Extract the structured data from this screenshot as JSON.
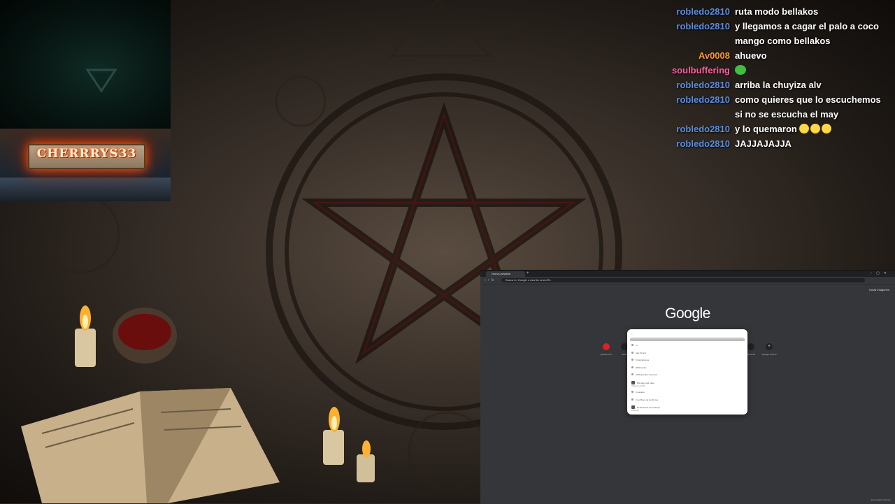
{
  "overlay": {
    "streamer_name": "CHERRRYS33"
  },
  "chat": {
    "messages": [
      {
        "user": "robledo2810",
        "user_color": "#5b8de0",
        "text": "ruta modo bellakos"
      },
      {
        "user": "robledo2810",
        "user_color": "#5b8de0",
        "text": "y llegamos a cagar el palo a coco mango como bellakos"
      },
      {
        "user": "Av0008",
        "user_color": "#ff9a2a",
        "text": "ahuevo"
      },
      {
        "user": "soulbuffering",
        "user_color": "#ff5fa0",
        "text": "",
        "emote": "frog-emote"
      },
      {
        "user": "robledo2810",
        "user_color": "#5b8de0",
        "text": "arriba la chuyiza alv"
      },
      {
        "user": "robledo2810",
        "user_color": "#5b8de0",
        "text": "como quieres que lo escuchemos si no se escucha el may"
      },
      {
        "user": "robledo2810",
        "user_color": "#5b8de0",
        "text": "y lo quemaron",
        "emote": "laugh-emote"
      },
      {
        "user": "robledo2810",
        "user_color": "#5b8de0",
        "text": "JAJJAJAJJA"
      }
    ]
  },
  "browser": {
    "tab_title": "Nueva pestaña",
    "address": "Busca en Google o escribe una URL",
    "profile_label": "Gmail  Imágenes",
    "logo_text": "Google",
    "search_value": "",
    "suggestions": [
      {
        "text": "to",
        "sub": ""
      },
      {
        "text": "tuky Shorts",
        "sub": ""
      },
      {
        "text": "5 ilustraciones",
        "sub": ""
      },
      {
        "text": "2000 tracks",
        "sub": ""
      },
      {
        "text": "1000 grandes anuncios",
        "sub": ""
      },
      {
        "text": "900 años del ruido",
        "sub": "Video de 2023",
        "image": true
      },
      {
        "text": "3 canales",
        "sub": ""
      },
      {
        "text": "2 de Mayo de las Flores",
        "sub": ""
      },
      {
        "text": "El Santuario de la Monja",
        "sub": "Película",
        "image": true
      }
    ],
    "shortcuts": [
      {
        "label": "youtube.com"
      },
      {
        "label": "twitch"
      },
      {
        "label": "facebook"
      },
      {
        "label": "Agregar acceso"
      }
    ],
    "customize_label": "Personalizar Chrome"
  },
  "colors": {
    "chat_text": "#ffffff",
    "browser_bg": "#35363a"
  }
}
